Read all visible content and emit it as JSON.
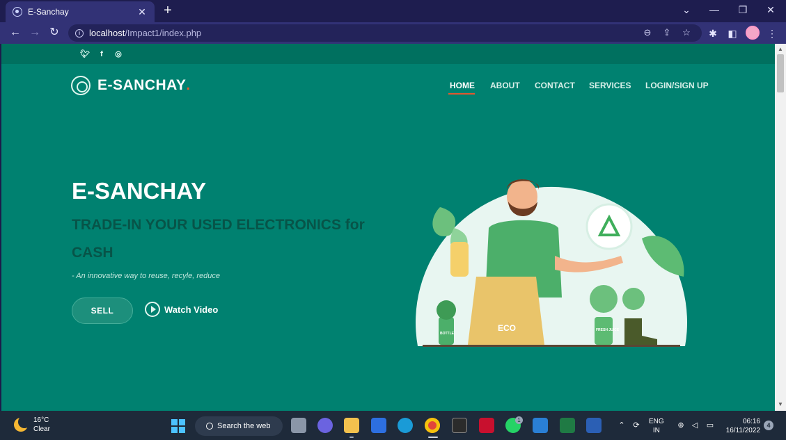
{
  "browser": {
    "tab_title": "E-Sanchay",
    "tab_close": "✕",
    "new_tab": "+",
    "url_host": "localhost",
    "url_path": "/Impact1/index.php"
  },
  "site": {
    "brand_name": "E-SANCHAY",
    "brand_dot": ".",
    "nav": [
      "HOME",
      "ABOUT",
      "CONTACT",
      "SERVICES",
      "LOGIN/SIGN UP"
    ],
    "social_icons": [
      "twitter-icon",
      "facebook-icon",
      "instagram-icon"
    ],
    "accent_color": "#e4572e",
    "background_color": "#008170"
  },
  "hero": {
    "title": "E-SANCHAY",
    "subtitle": "TRADE-IN YOUR USED ELECTRONICS for CASH",
    "tagline": "- An innovative way to reuse, recyle, reduce",
    "sell_label": "SELL",
    "watch_label": "Watch Video",
    "illustration_labels": {
      "bag": "ECO",
      "bottle": "BOTTLE",
      "jar": "FRESH JUICE"
    }
  },
  "taskbar": {
    "temperature": "16°C",
    "condition": "Clear",
    "search_placeholder": "Search the web",
    "language": "ENG",
    "region": "IN",
    "time": "06:16",
    "date": "16/11/2022",
    "notification_count": "4",
    "whatsapp_badge": "1"
  }
}
